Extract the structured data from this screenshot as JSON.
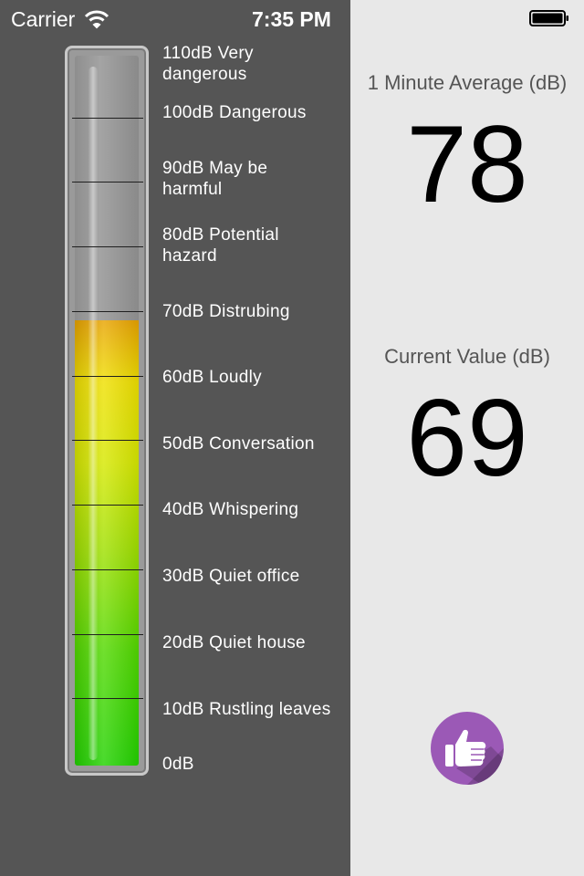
{
  "status_bar": {
    "carrier": "Carrier",
    "time": "7:35 PM",
    "wifi_icon": "wifi-icon",
    "battery_icon": "battery-icon"
  },
  "meter": {
    "current_level_db": 69,
    "max_db": 110,
    "levels": [
      {
        "db": 110,
        "label": "110dB Very dangerous"
      },
      {
        "db": 100,
        "label": "100dB Dangerous"
      },
      {
        "db": 90,
        "label": "90dB May be harmful"
      },
      {
        "db": 80,
        "label": "80dB Potential hazard"
      },
      {
        "db": 70,
        "label": "70dB Distrubing"
      },
      {
        "db": 60,
        "label": "60dB Loudly"
      },
      {
        "db": 50,
        "label": "50dB Conversation"
      },
      {
        "db": 40,
        "label": "40dB Whispering"
      },
      {
        "db": 30,
        "label": "30dB Quiet office"
      },
      {
        "db": 20,
        "label": "20dB Quiet house"
      },
      {
        "db": 10,
        "label": "10dB Rustling leaves"
      },
      {
        "db": 0,
        "label": "0dB"
      }
    ]
  },
  "readings": {
    "average_title": "1 Minute Average (dB)",
    "average_value": "78",
    "current_title": "Current Value (dB)",
    "current_value": "69"
  },
  "action": {
    "icon": "thumbs-up-icon",
    "color": "#9b59b6"
  }
}
